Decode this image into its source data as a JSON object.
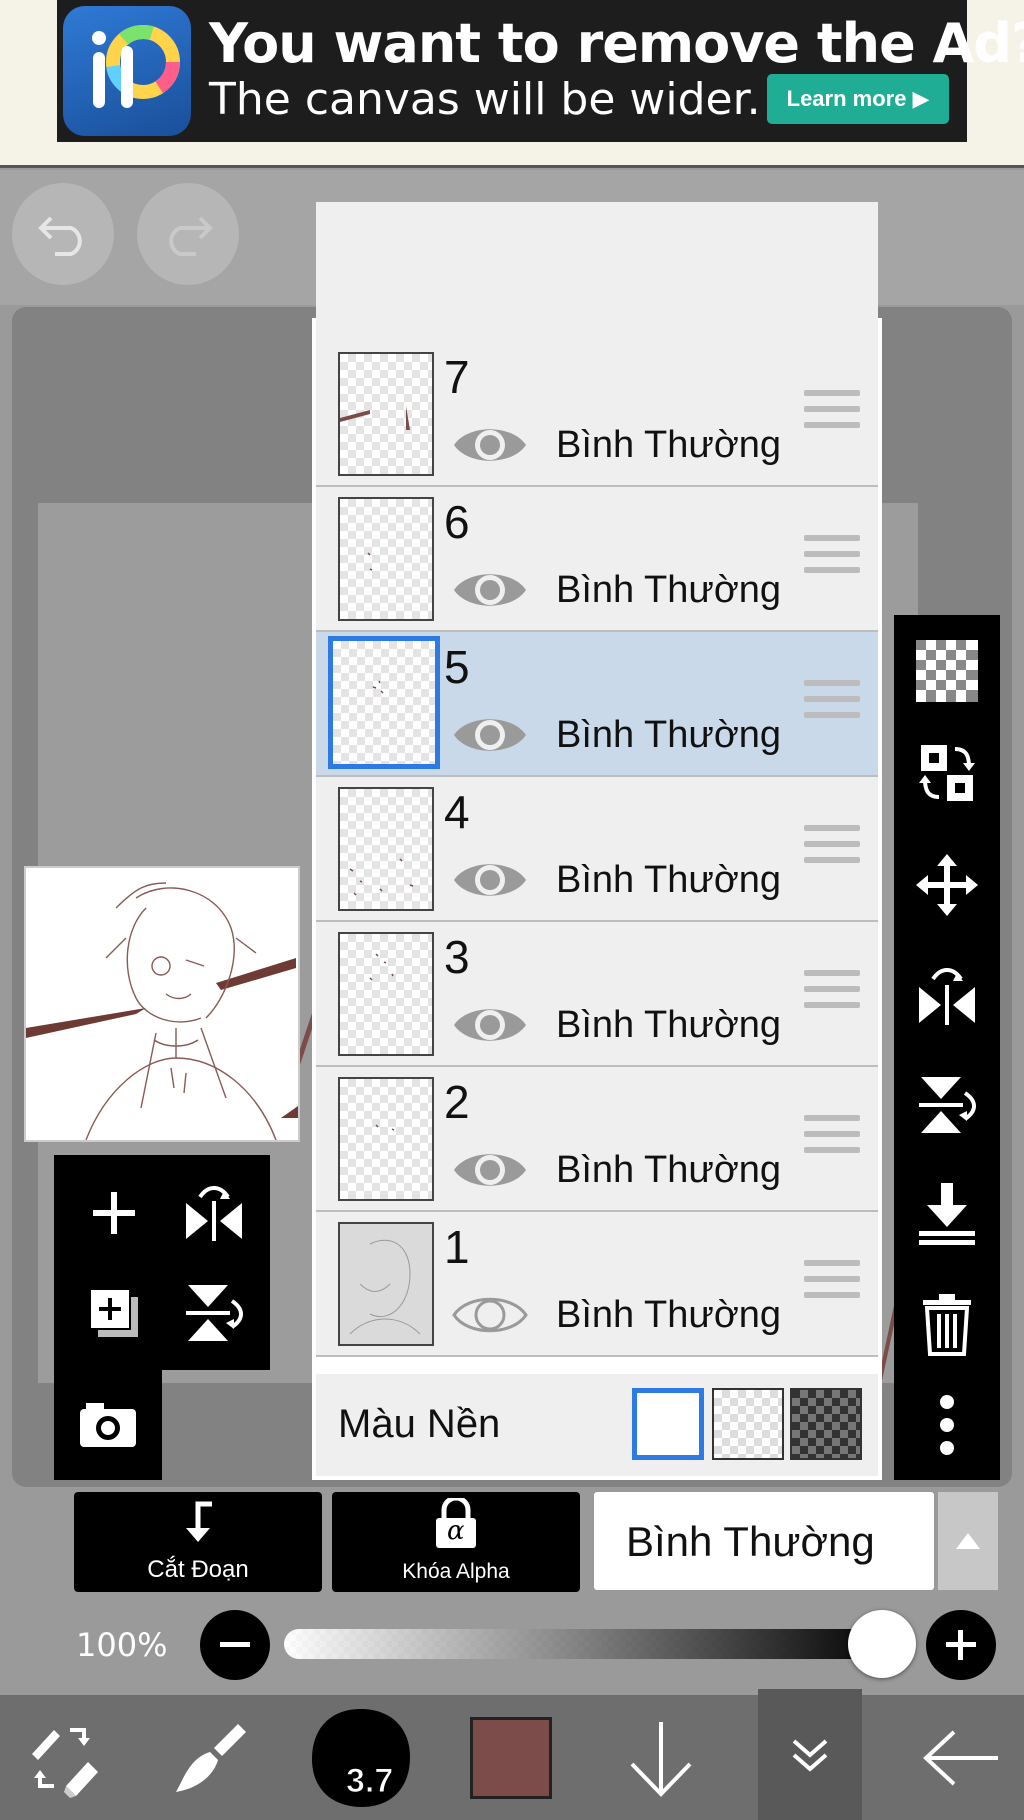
{
  "ad": {
    "title": "You want to remove the Ad?",
    "subtitle": "The canvas will be wider.",
    "cta": "Learn more"
  },
  "layers": [
    {
      "number": "7",
      "mode": "Bình Thường",
      "visible": true,
      "selected": false
    },
    {
      "number": "6",
      "mode": "Bình Thường",
      "visible": true,
      "selected": false
    },
    {
      "number": "5",
      "mode": "Bình Thường",
      "visible": true,
      "selected": true
    },
    {
      "number": "4",
      "mode": "Bình Thường",
      "visible": true,
      "selected": false
    },
    {
      "number": "3",
      "mode": "Bình Thường",
      "visible": true,
      "selected": false
    },
    {
      "number": "2",
      "mode": "Bình Thường",
      "visible": true,
      "selected": false
    },
    {
      "number": "1",
      "mode": "Bình Thường",
      "visible": false,
      "selected": false
    }
  ],
  "background": {
    "label": "Màu Nền",
    "selected": "white"
  },
  "controls": {
    "cut_label": "Cắt Đoạn",
    "alpha_label": "Khóa Alpha",
    "alpha_glyph": "α",
    "blend_mode": "Bình Thường"
  },
  "opacity": {
    "label": "100%",
    "value": 1.0
  },
  "bottom": {
    "brush_size": "3.7"
  },
  "colors": {
    "accent": "#2d7ae3",
    "selected_row": "#cad9ea",
    "current_color": "#7b4c4a",
    "ad_button": "#1fae95"
  }
}
